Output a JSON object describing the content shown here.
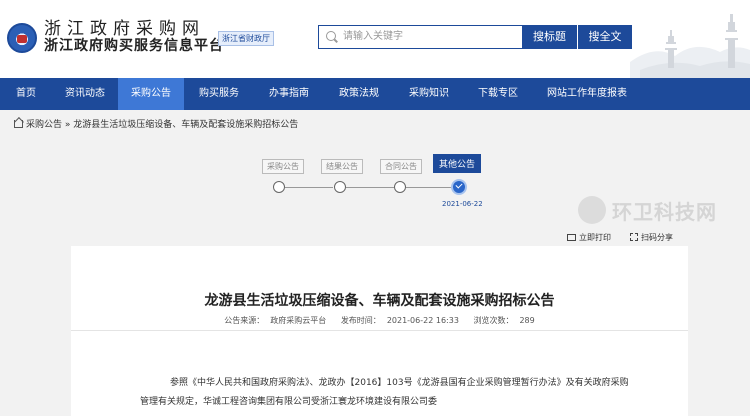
{
  "header": {
    "site_title": "浙江政府采购网",
    "site_subtitle": "浙江政府购买服务信息平台",
    "dept_badge": "浙江省财政厅",
    "search_placeholder": "请输入关键字",
    "btn_search_title": "搜标题",
    "btn_search_all": "搜全文"
  },
  "nav": {
    "items": [
      {
        "label": "首页",
        "width": 52
      },
      {
        "label": "资讯动态",
        "width": 66
      },
      {
        "label": "采购公告",
        "width": 66
      },
      {
        "label": "购买服务",
        "width": 70
      },
      {
        "label": "办事指南",
        "width": 70
      },
      {
        "label": "政策法规",
        "width": 70
      },
      {
        "label": "采购知识",
        "width": 70
      },
      {
        "label": "下载专区",
        "width": 68
      },
      {
        "label": "网站工作年度报表",
        "width": 110
      }
    ],
    "active_index": 2
  },
  "breadcrumb": {
    "section": "采购公告",
    "separator": " » ",
    "current": "龙游县生活垃圾压缩设备、车辆及配套设施采购招标公告"
  },
  "stepper": {
    "steps": [
      "采购公告",
      "结果公告",
      "合同公告",
      "其他公告"
    ],
    "active_index": 3,
    "active_date": "2021-06-22"
  },
  "watermark": {
    "text": "环卫科技网"
  },
  "actions": {
    "print": "立即打印",
    "share": "扫码分享"
  },
  "article": {
    "title": "龙游县生活垃圾压缩设备、车辆及配套设施采购招标公告",
    "source_label": "公告来源：",
    "source_value": "政府采购云平台",
    "time_label": "发布时间：",
    "time_value": "2021-06-22 16:33",
    "views_label": "浏览次数：",
    "views_value": "289",
    "body": "参照《中华人民共和国政府采购法》、龙政办【2016】103号《龙游县国有企业采购管理暂行办法》及有关政府采购管理有关规定，华诚工程咨询集团有限公司受浙江寰龙环境建设有限公司委"
  },
  "colors": {
    "primary": "#1d4a9a",
    "nav_active": "#3e78d6"
  }
}
